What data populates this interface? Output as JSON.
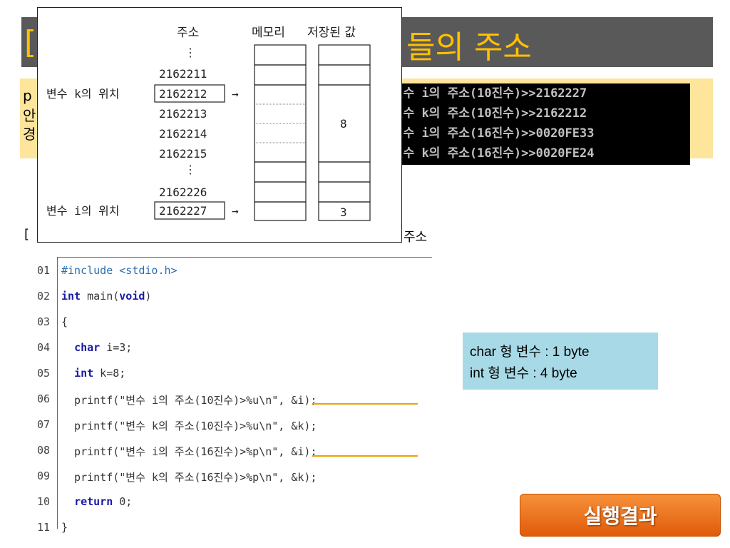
{
  "slide": {
    "title_left_fragment": "[",
    "title_right_fragment": "들의 주소",
    "yellow_lines": [
      "p",
      "안",
      "경"
    ],
    "caption_left": "[",
    "caption_right": "주소"
  },
  "console": {
    "lines": [
      "변수 i의 주소(10진수)>>2162227",
      "변수 k의 주소(10진수)>>2162212",
      "변수 i의 주소(16진수)>>0020FE33",
      "변수 k의 주소(16진수)>>0020FE24"
    ]
  },
  "diagram": {
    "header_address": "주소",
    "header_memory": "메모리",
    "header_value": "저장된 값",
    "dots": "⋮",
    "addresses": [
      "2162211",
      "2162212",
      "2162213",
      "2162214",
      "2162215",
      "2162226",
      "2162227"
    ],
    "label_k": "변수 k의 위치",
    "label_i": "변수 i의 위치",
    "arrow": "→",
    "value_k": "8",
    "value_i": "3"
  },
  "code": {
    "line_numbers": [
      "01",
      "02",
      "03",
      "04",
      "05",
      "06",
      "07",
      "08",
      "09",
      "10",
      "11"
    ],
    "lines": [
      {
        "parts": [
          {
            "t": "#include <stdio.h>",
            "c": "pp"
          }
        ]
      },
      {
        "parts": [
          {
            "t": "int",
            "c": "kw"
          },
          {
            "t": " main("
          },
          {
            "t": "void",
            "c": "kw"
          },
          {
            "t": ")"
          }
        ]
      },
      {
        "parts": [
          {
            "t": "{"
          }
        ]
      },
      {
        "parts": [
          {
            "t": "  "
          },
          {
            "t": "char",
            "c": "kw"
          },
          {
            "t": " i=3;"
          }
        ]
      },
      {
        "parts": [
          {
            "t": "  "
          },
          {
            "t": "int",
            "c": "kw"
          },
          {
            "t": " k=8;"
          }
        ]
      },
      {
        "parts": [
          {
            "t": "  printf(\"변수 i의 주소(10진수)>%u\\n\", &i);"
          }
        ]
      },
      {
        "parts": [
          {
            "t": "  printf(\"변수 k의 주소(10진수)>%u\\n\", &k);"
          }
        ]
      },
      {
        "parts": [
          {
            "t": "  printf(\"변수 i의 주소(16진수)>%p\\n\", &i);"
          }
        ]
      },
      {
        "parts": [
          {
            "t": "  printf(\"변수 k의 주소(16진수)>%p\\n\", &k);"
          }
        ]
      },
      {
        "parts": [
          {
            "t": "  "
          },
          {
            "t": "return",
            "c": "kw"
          },
          {
            "t": " 0;"
          }
        ]
      },
      {
        "parts": [
          {
            "t": "}"
          }
        ]
      }
    ]
  },
  "info": {
    "line1": "char 형 변수 : 1 byte",
    "line2": "int 형 변수 : 4 byte"
  },
  "run_button": {
    "label": "실행결과"
  },
  "colors": {
    "accent": "#ffc000",
    "title_band": "#595959",
    "highlight": "#fde59c",
    "info": "#a8d9e6",
    "button": "#ee7a20"
  }
}
